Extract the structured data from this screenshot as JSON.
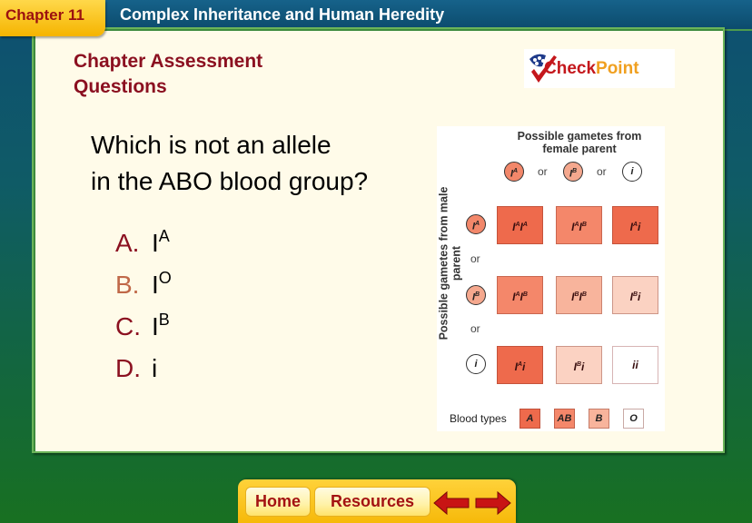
{
  "header": {
    "chapter": "Chapter 11",
    "title": "Complex Inheritance and Human Heredity"
  },
  "section": {
    "line1": "Chapter Assessment",
    "line2": "Questions"
  },
  "logo": {
    "check": "Check",
    "point": "Point"
  },
  "question": {
    "line1": "Which is not an allele",
    "line2": "in the ABO blood group?"
  },
  "answers": [
    {
      "letter": "A.",
      "base": "I",
      "sup": "A",
      "selected": false
    },
    {
      "letter": "B.",
      "base": "I",
      "sup": "O",
      "selected": true
    },
    {
      "letter": "C.",
      "base": "I",
      "sup": "B",
      "selected": false
    },
    {
      "letter": "D.",
      "base": "i",
      "sup": "",
      "selected": false
    }
  ],
  "punnett": {
    "top_label_1": "Possible gametes from",
    "top_label_2": "female parent",
    "side_label": "Possible gametes from male parent",
    "or": "or",
    "female_gametes": [
      {
        "base": "I",
        "sup": "A"
      },
      {
        "base": "I",
        "sup": "B"
      },
      {
        "base": "i",
        "sup": ""
      }
    ],
    "male_gametes": [
      {
        "base": "I",
        "sup": "A"
      },
      {
        "base": "I",
        "sup": "B"
      },
      {
        "base": "i",
        "sup": ""
      }
    ],
    "cells": [
      [
        {
          "g1": "I",
          "s1": "A",
          "g2": "I",
          "s2": "A",
          "type": "A"
        },
        {
          "g1": "I",
          "s1": "A",
          "g2": "I",
          "s2": "B",
          "type": "AB"
        },
        {
          "g1": "I",
          "s1": "A",
          "g2": "i",
          "s2": "",
          "type": "A"
        }
      ],
      [
        {
          "g1": "I",
          "s1": "A",
          "g2": "I",
          "s2": "B",
          "type": "AB"
        },
        {
          "g1": "I",
          "s1": "B",
          "g2": "I",
          "s2": "B",
          "type": "B"
        },
        {
          "g1": "I",
          "s1": "B",
          "g2": "i",
          "s2": "",
          "type": "Bi"
        }
      ],
      [
        {
          "g1": "I",
          "s1": "A",
          "g2": "i",
          "s2": "",
          "type": "A"
        },
        {
          "g1": "I",
          "s1": "B",
          "g2": "i",
          "s2": "",
          "type": "Bi"
        },
        {
          "g1": "ii",
          "s1": "",
          "g2": "",
          "s2": "",
          "type": "O"
        }
      ]
    ],
    "blood_types_label": "Blood types",
    "blood_types": [
      "A",
      "AB",
      "B",
      "O"
    ],
    "colors": {
      "A": "#ee6a4c",
      "AB": "#f4876a",
      "B": "#f8b49c",
      "O": "#ffffff"
    }
  },
  "nav": {
    "home": "Home",
    "resources": "Resources",
    "back": "previous",
    "forward": "next"
  }
}
